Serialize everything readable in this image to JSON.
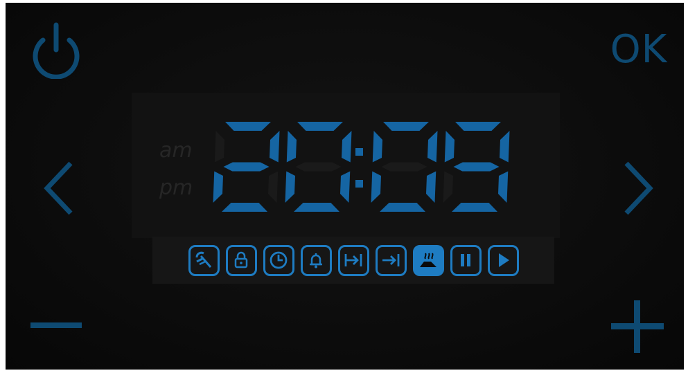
{
  "panel": {
    "ok_label": "OK",
    "am_label": "am",
    "pm_label": "pm"
  },
  "display": {
    "time": "20:09",
    "hours": "20",
    "minutes": "09",
    "digit_color": "#1565a3",
    "ghost_color": "#1a1a1a"
  },
  "controls": {
    "accent_color": "#0e4a72",
    "left": "power-icon",
    "right_top": "ok",
    "prev": "chevron-left-icon",
    "next": "chevron-right-icon",
    "decrease": "minus-icon",
    "increase": "plus-icon"
  },
  "function_icons": [
    "cleaning-brush-icon",
    "lock-icon",
    "clock-icon",
    "bell-icon",
    "duration-icon",
    "end-time-icon",
    "steam-tray-icon",
    "pause-icon",
    "play-icon"
  ],
  "icon_color": "#1e7cc2"
}
